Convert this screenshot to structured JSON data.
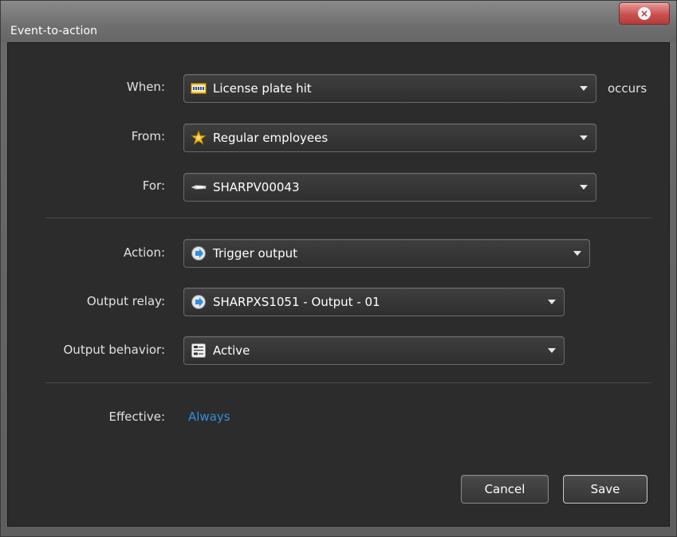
{
  "window": {
    "title": "Event-to-action",
    "close_glyph": "×",
    "close_color": "#c9504f"
  },
  "form": {
    "when": {
      "label": "When:",
      "value": "License plate hit",
      "icon": "license-plate-icon",
      "suffix": "occurs"
    },
    "from": {
      "label": "From:",
      "value": "Regular employees",
      "icon": "star-badge-icon"
    },
    "for": {
      "label": "For:",
      "value": "SHARPV00043",
      "icon": "camera-icon"
    },
    "action": {
      "label": "Action:",
      "value": "Trigger output",
      "icon": "output-arrow-icon"
    },
    "output_relay": {
      "label": "Output relay:",
      "value": "SHARPXS1051 - Output - 01",
      "icon": "output-arrow-icon"
    },
    "output_behavior": {
      "label": "Output behavior:",
      "value": "Active",
      "icon": "behavior-icon"
    },
    "effective": {
      "label": "Effective:",
      "value": "Always"
    }
  },
  "buttons": {
    "cancel": "Cancel",
    "save": "Save"
  },
  "colors": {
    "panel_bg": "#2c2c2c",
    "link": "#2f8fe0",
    "text": "#e2e2e2"
  }
}
